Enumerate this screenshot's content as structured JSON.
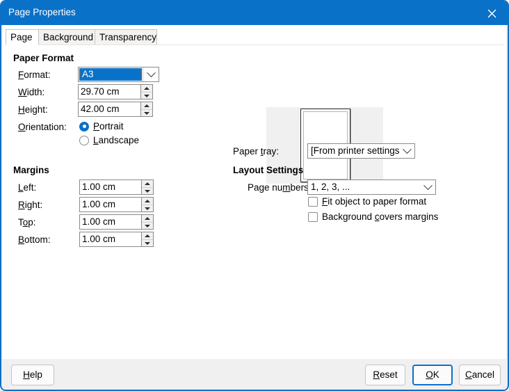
{
  "window": {
    "title": "Page Properties",
    "close_icon": "close-icon",
    "accent_color": "#0a71c8"
  },
  "tabs": [
    {
      "label": "Page",
      "active": true
    },
    {
      "label": "Background",
      "active": false
    },
    {
      "label": "Transparency",
      "active": false
    }
  ],
  "paper_format": {
    "group_title": "Paper Format",
    "format": {
      "label": "Format:",
      "value": "A3"
    },
    "width": {
      "label": "Width:",
      "value": "29.70 cm"
    },
    "height": {
      "label": "Height:",
      "value": "42.00 cm"
    },
    "orientation": {
      "label": "Orientation:",
      "portrait": "Portrait",
      "landscape": "Landscape",
      "selected": "Portrait"
    }
  },
  "margins": {
    "group_title": "Margins",
    "left": {
      "label": "Left:",
      "value": "1.00 cm"
    },
    "right": {
      "label": "Right:",
      "value": "1.00 cm"
    },
    "top": {
      "label": "Top:",
      "value": "1.00 cm"
    },
    "bottom": {
      "label": "Bottom:",
      "value": "1.00 cm"
    }
  },
  "paper_tray": {
    "label": "Paper tray:",
    "value": "[From printer settings]"
  },
  "layout_settings": {
    "group_title": "Layout Settings",
    "page_numbers": {
      "label": "Page numbers:",
      "value": "1, 2, 3, ..."
    },
    "fit_object": {
      "label": "Fit object to paper format",
      "checked": false
    },
    "background_covers": {
      "label": "Background covers margins",
      "checked": false
    }
  },
  "buttons": {
    "help": "Help",
    "reset": "Reset",
    "ok": "OK",
    "cancel": "Cancel"
  }
}
